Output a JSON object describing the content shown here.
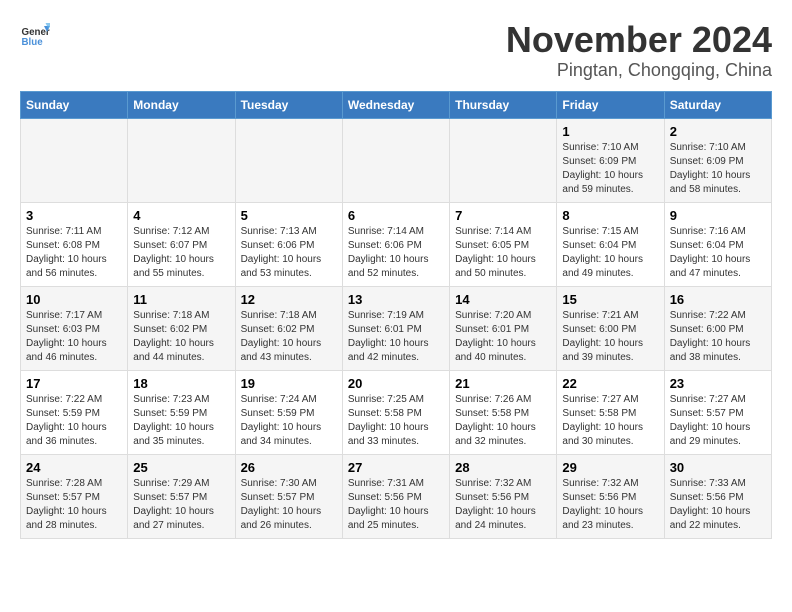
{
  "header": {
    "logo_general": "General",
    "logo_blue": "Blue",
    "title": "November 2024",
    "subtitle": "Pingtan, Chongqing, China"
  },
  "weekdays": [
    "Sunday",
    "Monday",
    "Tuesday",
    "Wednesday",
    "Thursday",
    "Friday",
    "Saturday"
  ],
  "weeks": [
    [
      {
        "day": "",
        "info": ""
      },
      {
        "day": "",
        "info": ""
      },
      {
        "day": "",
        "info": ""
      },
      {
        "day": "",
        "info": ""
      },
      {
        "day": "",
        "info": ""
      },
      {
        "day": "1",
        "info": "Sunrise: 7:10 AM\nSunset: 6:09 PM\nDaylight: 10 hours and 59 minutes."
      },
      {
        "day": "2",
        "info": "Sunrise: 7:10 AM\nSunset: 6:09 PM\nDaylight: 10 hours and 58 minutes."
      }
    ],
    [
      {
        "day": "3",
        "info": "Sunrise: 7:11 AM\nSunset: 6:08 PM\nDaylight: 10 hours and 56 minutes."
      },
      {
        "day": "4",
        "info": "Sunrise: 7:12 AM\nSunset: 6:07 PM\nDaylight: 10 hours and 55 minutes."
      },
      {
        "day": "5",
        "info": "Sunrise: 7:13 AM\nSunset: 6:06 PM\nDaylight: 10 hours and 53 minutes."
      },
      {
        "day": "6",
        "info": "Sunrise: 7:14 AM\nSunset: 6:06 PM\nDaylight: 10 hours and 52 minutes."
      },
      {
        "day": "7",
        "info": "Sunrise: 7:14 AM\nSunset: 6:05 PM\nDaylight: 10 hours and 50 minutes."
      },
      {
        "day": "8",
        "info": "Sunrise: 7:15 AM\nSunset: 6:04 PM\nDaylight: 10 hours and 49 minutes."
      },
      {
        "day": "9",
        "info": "Sunrise: 7:16 AM\nSunset: 6:04 PM\nDaylight: 10 hours and 47 minutes."
      }
    ],
    [
      {
        "day": "10",
        "info": "Sunrise: 7:17 AM\nSunset: 6:03 PM\nDaylight: 10 hours and 46 minutes."
      },
      {
        "day": "11",
        "info": "Sunrise: 7:18 AM\nSunset: 6:02 PM\nDaylight: 10 hours and 44 minutes."
      },
      {
        "day": "12",
        "info": "Sunrise: 7:18 AM\nSunset: 6:02 PM\nDaylight: 10 hours and 43 minutes."
      },
      {
        "day": "13",
        "info": "Sunrise: 7:19 AM\nSunset: 6:01 PM\nDaylight: 10 hours and 42 minutes."
      },
      {
        "day": "14",
        "info": "Sunrise: 7:20 AM\nSunset: 6:01 PM\nDaylight: 10 hours and 40 minutes."
      },
      {
        "day": "15",
        "info": "Sunrise: 7:21 AM\nSunset: 6:00 PM\nDaylight: 10 hours and 39 minutes."
      },
      {
        "day": "16",
        "info": "Sunrise: 7:22 AM\nSunset: 6:00 PM\nDaylight: 10 hours and 38 minutes."
      }
    ],
    [
      {
        "day": "17",
        "info": "Sunrise: 7:22 AM\nSunset: 5:59 PM\nDaylight: 10 hours and 36 minutes."
      },
      {
        "day": "18",
        "info": "Sunrise: 7:23 AM\nSunset: 5:59 PM\nDaylight: 10 hours and 35 minutes."
      },
      {
        "day": "19",
        "info": "Sunrise: 7:24 AM\nSunset: 5:59 PM\nDaylight: 10 hours and 34 minutes."
      },
      {
        "day": "20",
        "info": "Sunrise: 7:25 AM\nSunset: 5:58 PM\nDaylight: 10 hours and 33 minutes."
      },
      {
        "day": "21",
        "info": "Sunrise: 7:26 AM\nSunset: 5:58 PM\nDaylight: 10 hours and 32 minutes."
      },
      {
        "day": "22",
        "info": "Sunrise: 7:27 AM\nSunset: 5:58 PM\nDaylight: 10 hours and 30 minutes."
      },
      {
        "day": "23",
        "info": "Sunrise: 7:27 AM\nSunset: 5:57 PM\nDaylight: 10 hours and 29 minutes."
      }
    ],
    [
      {
        "day": "24",
        "info": "Sunrise: 7:28 AM\nSunset: 5:57 PM\nDaylight: 10 hours and 28 minutes."
      },
      {
        "day": "25",
        "info": "Sunrise: 7:29 AM\nSunset: 5:57 PM\nDaylight: 10 hours and 27 minutes."
      },
      {
        "day": "26",
        "info": "Sunrise: 7:30 AM\nSunset: 5:57 PM\nDaylight: 10 hours and 26 minutes."
      },
      {
        "day": "27",
        "info": "Sunrise: 7:31 AM\nSunset: 5:56 PM\nDaylight: 10 hours and 25 minutes."
      },
      {
        "day": "28",
        "info": "Sunrise: 7:32 AM\nSunset: 5:56 PM\nDaylight: 10 hours and 24 minutes."
      },
      {
        "day": "29",
        "info": "Sunrise: 7:32 AM\nSunset: 5:56 PM\nDaylight: 10 hours and 23 minutes."
      },
      {
        "day": "30",
        "info": "Sunrise: 7:33 AM\nSunset: 5:56 PM\nDaylight: 10 hours and 22 minutes."
      }
    ]
  ]
}
